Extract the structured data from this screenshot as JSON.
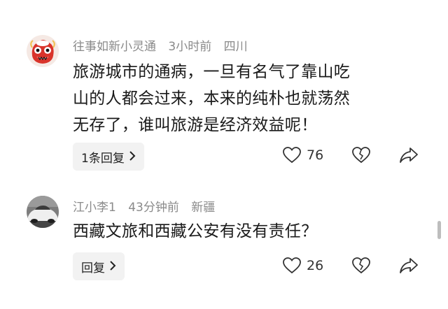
{
  "comments": [
    {
      "username": "往事如新小灵通",
      "time": "3小时前",
      "location": "四川",
      "lines": [
        "旅游城市的通病，一旦有名气了靠山吃",
        "山的人都会过来，本来的纯朴也就荡然",
        "无存了，谁叫旅游是经济效益呢！"
      ],
      "reply_label": "1条回复",
      "like_count": "76",
      "avatar_icon": "lion-dance-avatar"
    },
    {
      "username": "江小李1",
      "time": "43分钟前",
      "location": "新疆",
      "lines": [
        "西藏文旅和西藏公安有没有责任？"
      ],
      "reply_label": "回复",
      "like_count": "26",
      "avatar_icon": "car-photo-avatar"
    }
  ],
  "icons": {
    "like": "heart-icon",
    "dislike": "broken-heart-icon",
    "share": "share-arrow-icon",
    "chevron": "chevron-right-icon"
  },
  "colors": {
    "meta_text": "#8a8a8a",
    "body_text": "#1a1a1a",
    "pill_bg": "#f2f2f2"
  }
}
